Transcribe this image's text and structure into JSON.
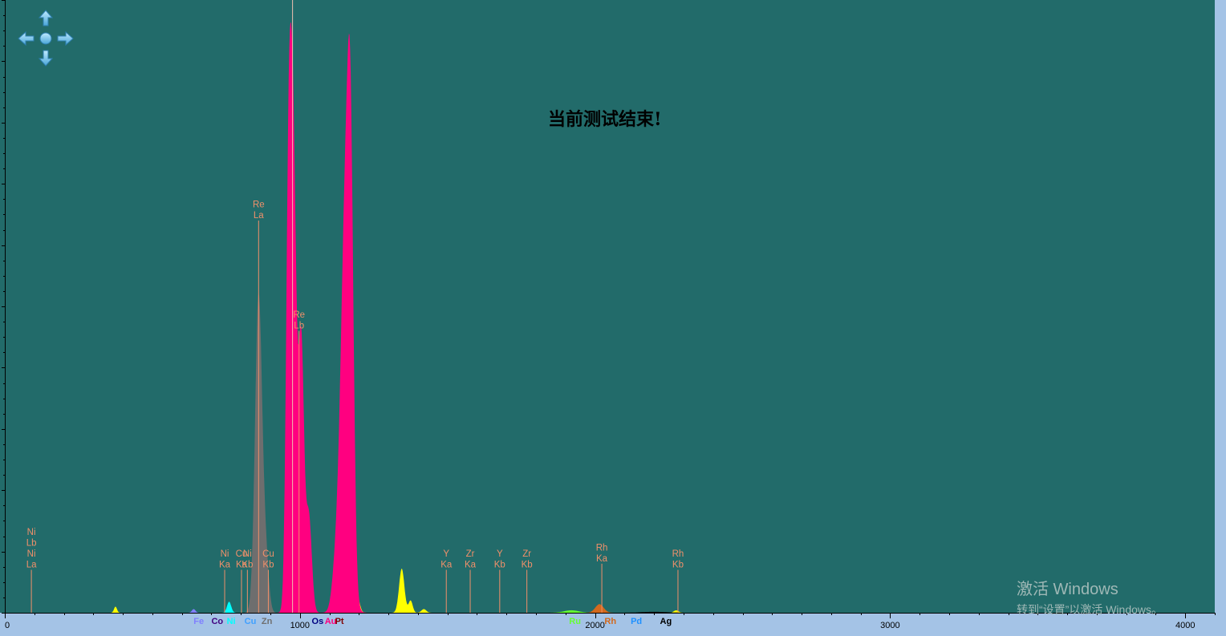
{
  "status": {
    "message": "当前测试结束!"
  },
  "watermark": {
    "title": "激活 Windows",
    "subtitle": "转到“设置”以激活 Windows。"
  },
  "nav": {
    "icons": [
      "arrow-up-icon",
      "arrow-left-icon",
      "center-dot-icon",
      "arrow-right-icon",
      "arrow-down-icon"
    ]
  },
  "colors": {
    "background": "#226b6a",
    "axis_bar": "#a4c3e6",
    "peak_label": "#f0906a",
    "yellow": "#ffff00",
    "magenta": "#ff0080",
    "gray": "#6e6e6e",
    "cyan": "#00ffff"
  },
  "chart_data": {
    "type": "area",
    "title": "",
    "xlabel": "",
    "ylabel": "",
    "xlim": [
      0,
      4100
    ],
    "ylim": [
      0,
      1000
    ],
    "x_ticks": [
      0,
      1000,
      2000,
      3000,
      4000
    ],
    "x_tick_labels": [
      "0",
      "1000",
      "2000",
      "3000",
      "4000"
    ],
    "grid": false,
    "cursor_x": 975,
    "series": [
      {
        "color": "#ffff00",
        "peaks": [
          [
            375,
            10,
            5
          ],
          [
            1195,
            25,
            8
          ],
          [
            1345,
            72,
            9
          ],
          [
            1375,
            20,
            7
          ],
          [
            1420,
            6,
            8
          ],
          [
            2275,
            4,
            8
          ]
        ]
      },
      {
        "color": "#8080ff",
        "peaks": [
          [
            640,
            6,
            6
          ]
        ]
      },
      {
        "color": "#00ffff",
        "peaks": [
          [
            760,
            18,
            7
          ]
        ]
      },
      {
        "color": "#6e6e6e",
        "peaks": [
          [
            860,
            520,
            12
          ],
          [
            885,
            80,
            10
          ]
        ]
      },
      {
        "color": "#ff0080",
        "peaks": [
          [
            975,
            840,
            12
          ],
          [
            960,
            420,
            8
          ],
          [
            1005,
            420,
            9
          ],
          [
            1030,
            160,
            10
          ],
          [
            1120,
            50,
            12
          ],
          [
            1155,
            595,
            16
          ],
          [
            1172,
            500,
            10
          ],
          [
            1150,
            80,
            20
          ]
        ]
      },
      {
        "color": "#66ff33",
        "peaks": [
          [
            1920,
            4,
            25
          ]
        ]
      },
      {
        "color": "#d2691e",
        "peaks": [
          [
            2015,
            14,
            14
          ]
        ]
      },
      {
        "color": "#000000",
        "peaks": [
          [
            2200,
            1.5,
            40
          ]
        ]
      }
    ],
    "peak_markers": [
      {
        "x": 90,
        "label": [
          "Ni",
          "Lb",
          "Ni",
          "La"
        ],
        "y": 70
      },
      {
        "x": 745,
        "label": [
          "Ni",
          "Ka"
        ],
        "y": 70
      },
      {
        "x": 802,
        "label": [
          "Cu",
          "Ka"
        ],
        "y": 70
      },
      {
        "x": 822,
        "label": [
          "Ni",
          "Kb"
        ],
        "y": 70
      },
      {
        "x": 893,
        "label": [
          "Cu",
          "Kb"
        ],
        "y": 70
      },
      {
        "x": 860,
        "label": [
          "Re",
          "La"
        ],
        "y": 640
      },
      {
        "x": 997,
        "label": [
          "Re",
          "Lb"
        ],
        "y": 460
      },
      {
        "x": 1496,
        "label": [
          "Y",
          "Ka"
        ],
        "y": 70
      },
      {
        "x": 1577,
        "label": [
          "Zr",
          "Ka"
        ],
        "y": 70
      },
      {
        "x": 1677,
        "label": [
          "Y",
          "Kb"
        ],
        "y": 70
      },
      {
        "x": 1769,
        "label": [
          "Zr",
          "Kb"
        ],
        "y": 70
      },
      {
        "x": 2023,
        "label": [
          "Rh",
          "Ka"
        ],
        "y": 80
      },
      {
        "x": 2281,
        "label": [
          "Rh",
          "Kb"
        ],
        "y": 70
      }
    ],
    "element_markers": [
      {
        "x": 657,
        "label": "Fe",
        "color": "#8080ff"
      },
      {
        "x": 720,
        "label": "Co",
        "color": "#400080"
      },
      {
        "x": 767,
        "label": "Ni",
        "color": "#00ffff"
      },
      {
        "x": 832,
        "label": "Cu",
        "color": "#40a0ff"
      },
      {
        "x": 888,
        "label": "Zn",
        "color": "#707070"
      },
      {
        "x": 1060,
        "label": "Os",
        "color": "#000080"
      },
      {
        "x": 1104,
        "label": "Au",
        "color": "#ff0080"
      },
      {
        "x": 1134,
        "label": "Pt",
        "color": "#800000"
      },
      {
        "x": 1932,
        "label": "Ru",
        "color": "#66ff33"
      },
      {
        "x": 2052,
        "label": "Rh",
        "color": "#d2691e"
      },
      {
        "x": 2140,
        "label": "Pd",
        "color": "#1e90ff"
      },
      {
        "x": 2240,
        "label": "Ag",
        "color": "#000000"
      }
    ]
  }
}
